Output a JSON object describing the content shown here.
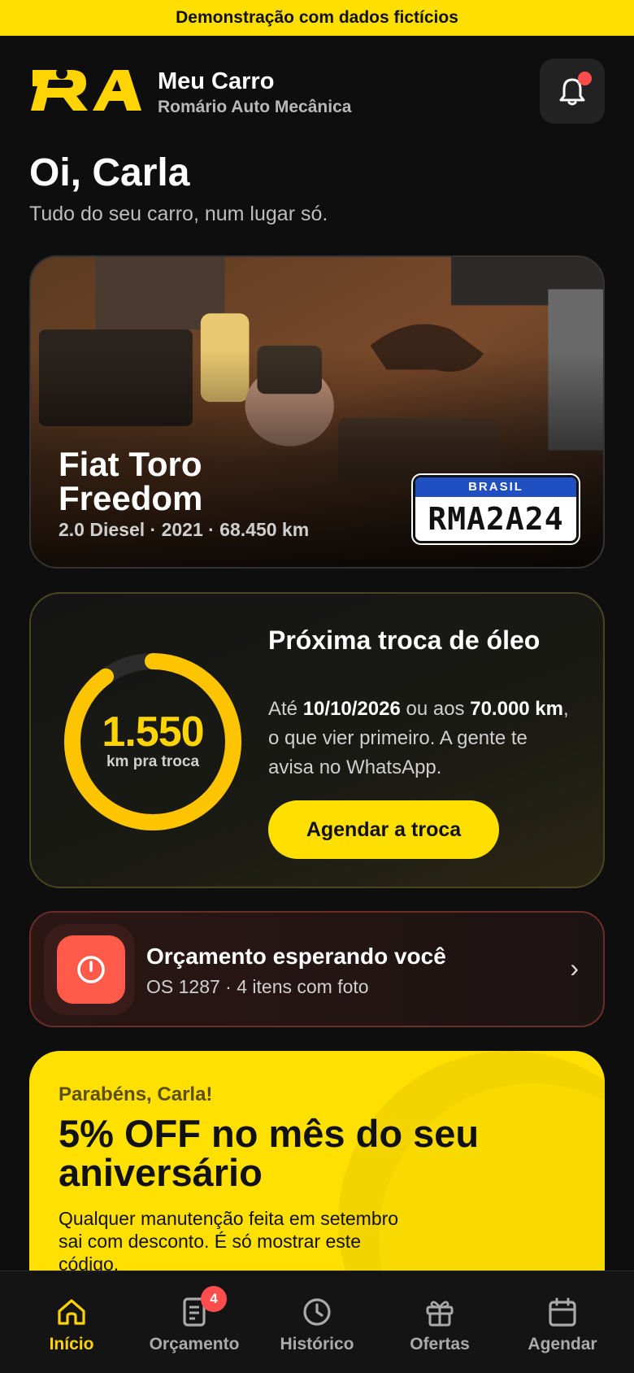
{
  "banner": {
    "text": "Demonstração com dados fictícios"
  },
  "header": {
    "logo_text": "RA",
    "title": "Meu Carro",
    "subtitle": "Romário Auto Mecânica",
    "notification_icon": "bell-icon"
  },
  "greeting": {
    "title": "Oi, Carla",
    "subtitle": "Tudo do seu carro, num lugar só."
  },
  "vehicle": {
    "name": "Fiat Toro Freedom",
    "details": "2.0 Diesel · 2021 · 68.450 km",
    "plate_country": "BRASIL",
    "plate_number": "RMA2A24"
  },
  "oil_change": {
    "remaining_km": "1.550",
    "remaining_label": "km pra troca",
    "progress_fraction": 0.9,
    "title": "Próxima troca de óleo",
    "text_prefix": "Até ",
    "date": "10/10/2026",
    "text_middle": " ou aos ",
    "km_limit": "70.000 km",
    "text_suffix": ", o que vier primeiro. A gente te avisa no WhatsApp.",
    "button_label": "Agendar a troca"
  },
  "quote": {
    "icon": "alert-clock-icon",
    "title": "Orçamento esperando você",
    "subtitle": "OS 1287 · 4 itens com foto",
    "chevron": "›"
  },
  "promo": {
    "kicker": "Parabéns, Carla!",
    "title": "5% OFF no mês do seu aniversário",
    "text": "Qualquer manutenção feita em setembro sai com desconto. É só mostrar este código."
  },
  "nav": {
    "items": [
      {
        "label": "Início",
        "icon": "home-icon",
        "active": true
      },
      {
        "label": "Orçamento",
        "icon": "document-icon",
        "badge": "4"
      },
      {
        "label": "Histórico",
        "icon": "clock-icon"
      },
      {
        "label": "Ofertas",
        "icon": "gift-icon"
      },
      {
        "label": "Agendar",
        "icon": "calendar-icon"
      }
    ]
  },
  "colors": {
    "accent": "#ffdf00",
    "alert": "#ff5a4a",
    "background": "#0e0e0e",
    "plate_blue": "#1f4fc1"
  }
}
